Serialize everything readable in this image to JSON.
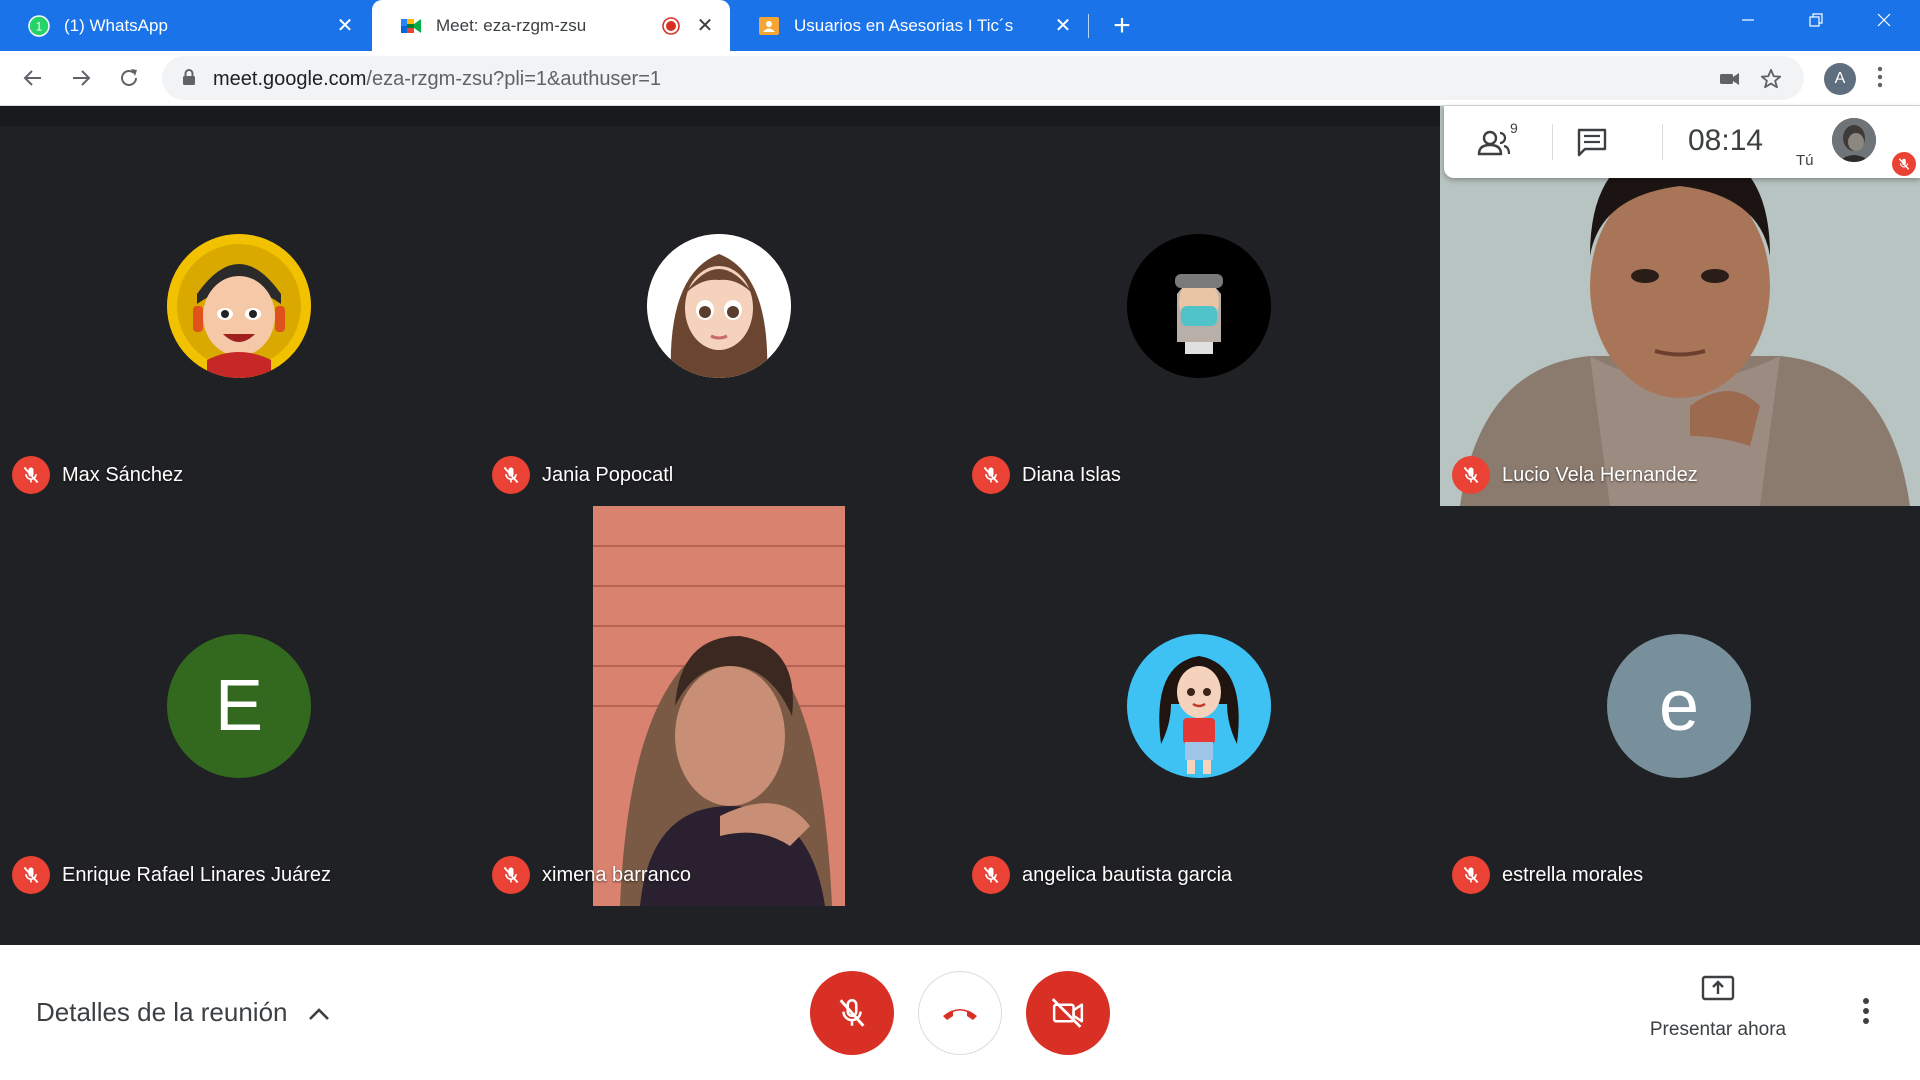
{
  "browser": {
    "tabs": [
      {
        "title": "(1) WhatsApp",
        "icon": "whatsapp-icon"
      },
      {
        "title": "Meet: eza-rzgm-zsu",
        "icon": "google-meet-icon",
        "recording": true
      },
      {
        "title": "Usuarios en Asesorias I Tic´s",
        "icon": "classroom-icon"
      }
    ],
    "url_host": "meet.google.com",
    "url_path": "/eza-rzgm-zsu?pli=1&authuser=1",
    "profile_initial": "A"
  },
  "meet": {
    "participant_count": "9",
    "clock": "08:14",
    "self_label": "Tú",
    "participants": [
      {
        "name": "Max Sánchez",
        "kind": "avatar-image",
        "muted": true
      },
      {
        "name": "Jania Popocatl",
        "kind": "avatar-image",
        "muted": true
      },
      {
        "name": "Diana Islas",
        "kind": "avatar-image",
        "muted": true
      },
      {
        "name": "Lucio Vela Hernandez",
        "kind": "video",
        "muted": true
      },
      {
        "name": "Enrique Rafael Linares Juárez",
        "kind": "letter",
        "letter": "E",
        "color": "#33691e",
        "muted": true
      },
      {
        "name": "ximena barranco",
        "kind": "video",
        "muted": true
      },
      {
        "name": "angelica bautista garcia",
        "kind": "avatar-image",
        "muted": true
      },
      {
        "name": "estrella morales",
        "kind": "letter",
        "letter": "e",
        "color": "#78909c",
        "muted": true
      }
    ]
  },
  "bottom": {
    "details_label": "Detalles de la reunión",
    "present_label": "Presentar ahora"
  },
  "colors": {
    "browser_blue": "#1a73e8",
    "stage_bg": "#202124",
    "mute_red": "#ea4335",
    "control_red": "#d93025"
  }
}
